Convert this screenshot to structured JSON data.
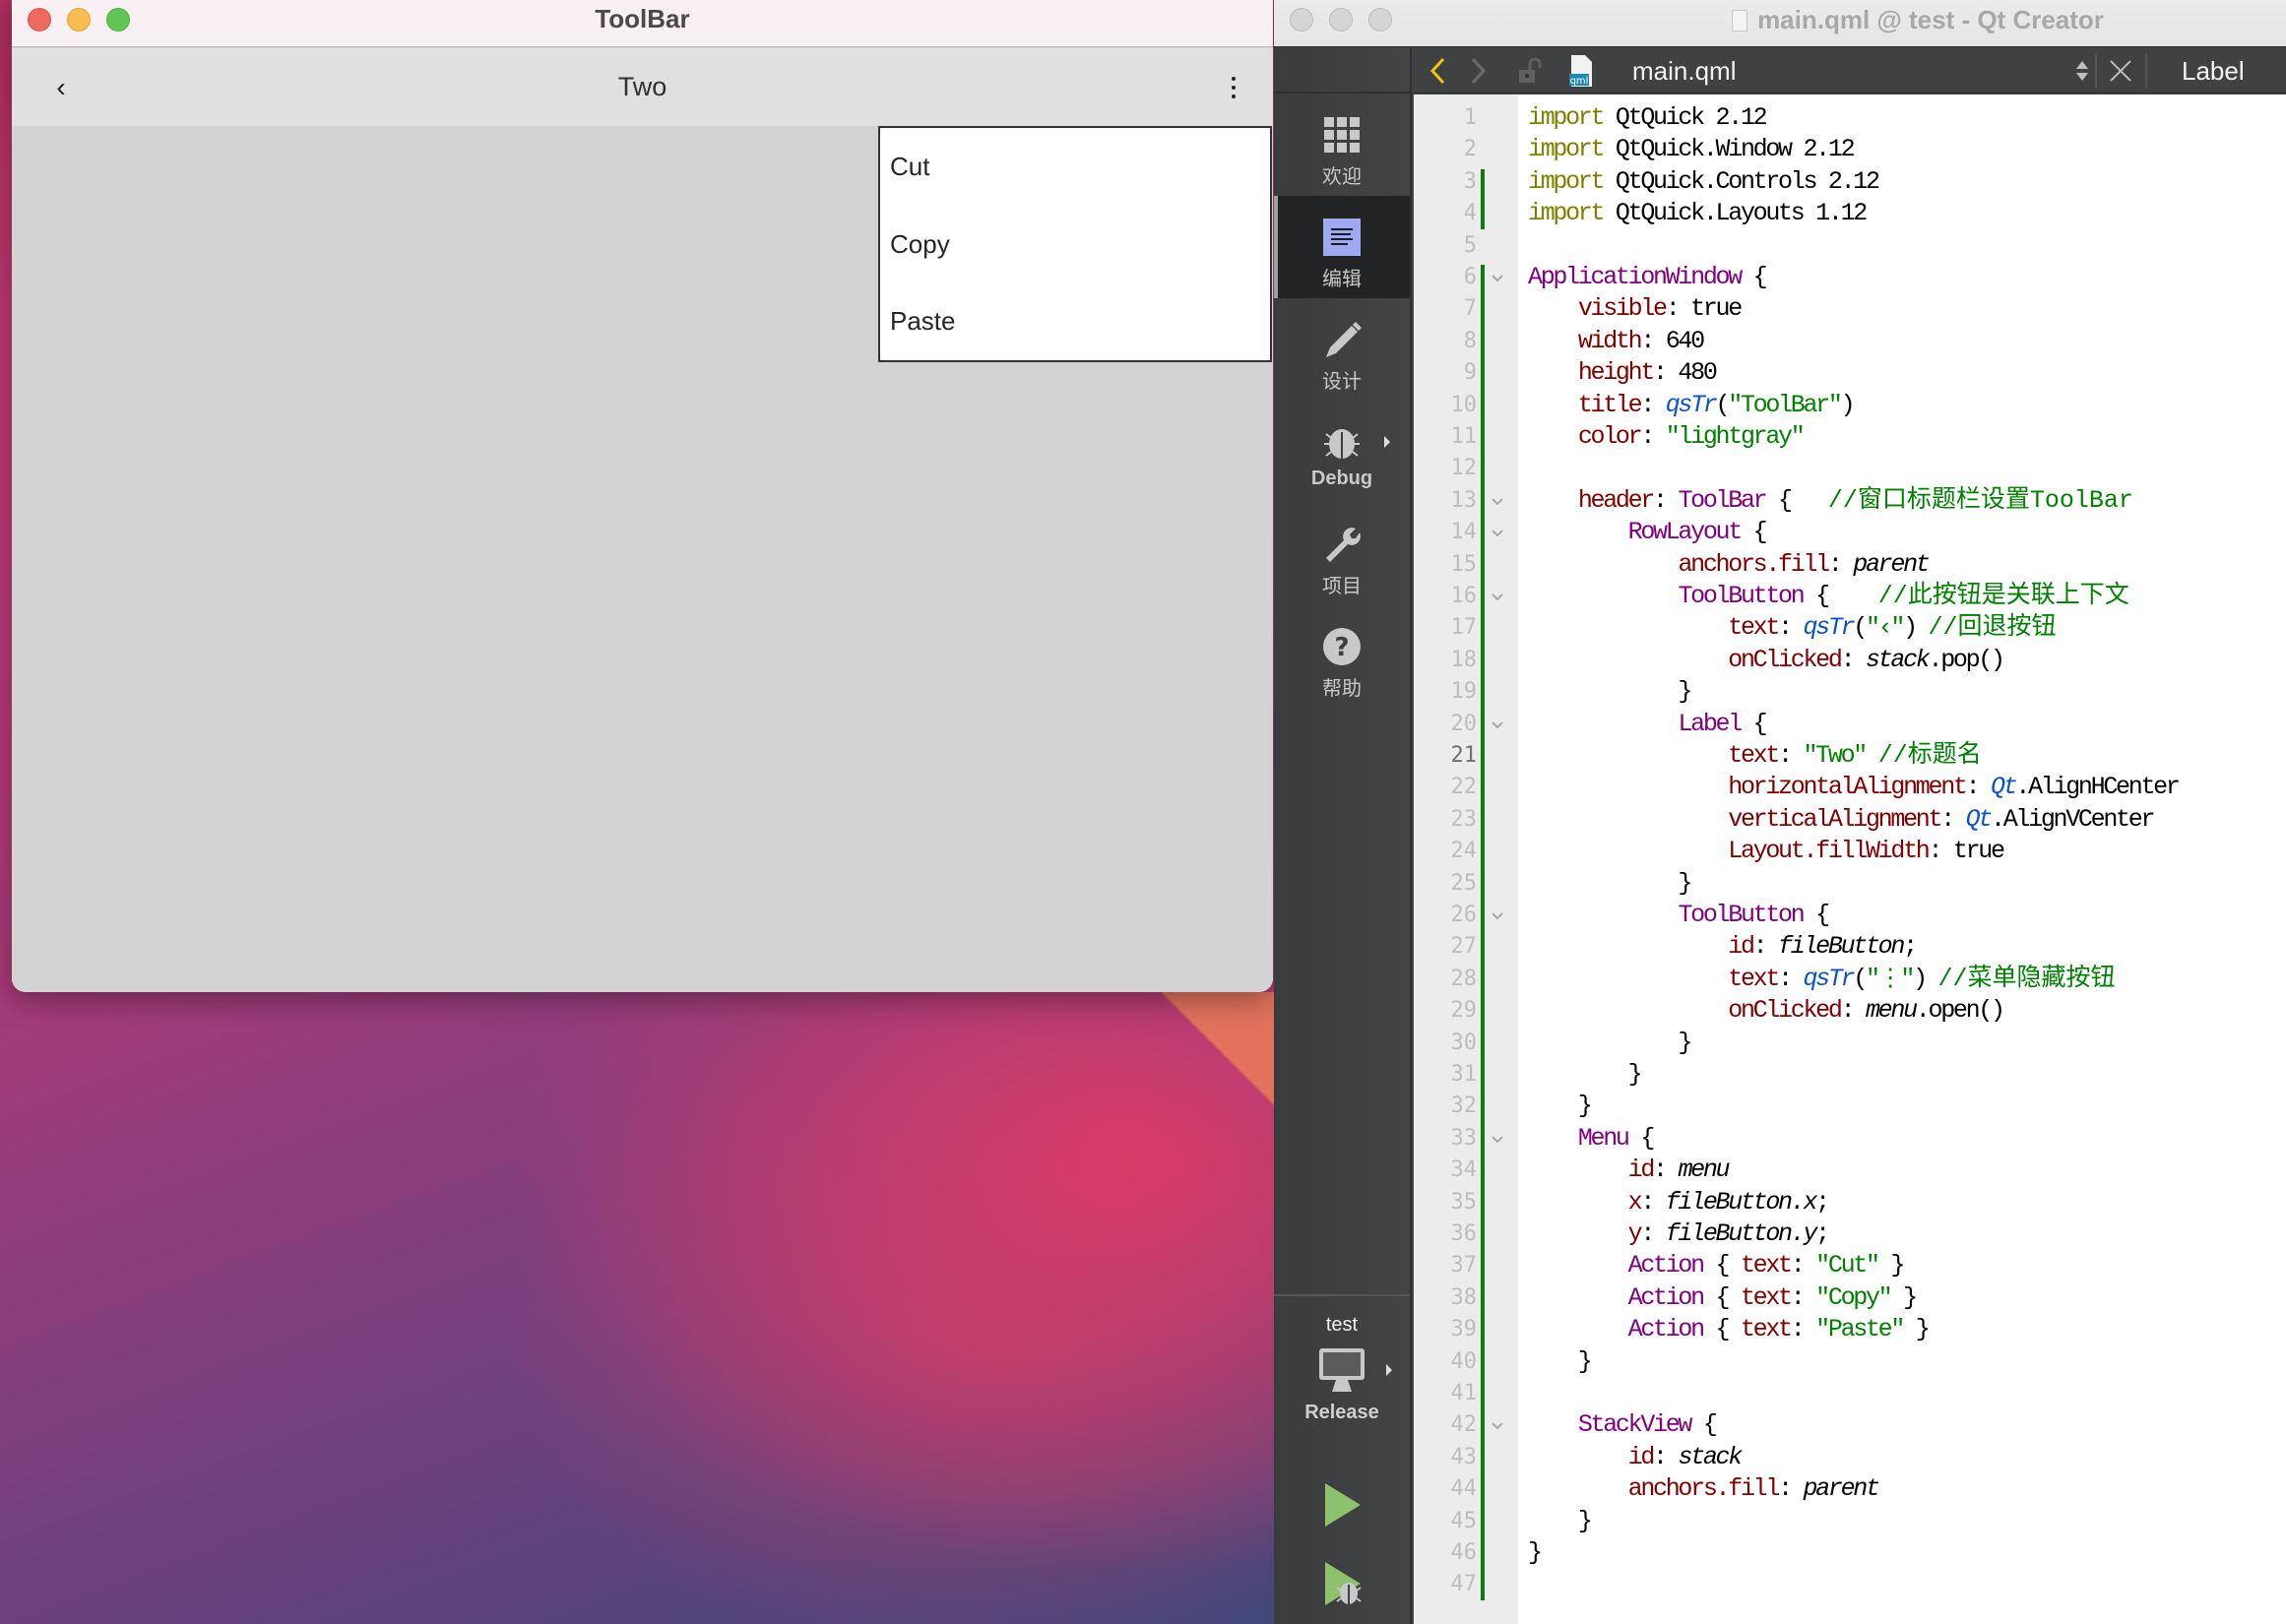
{
  "toolbar_app": {
    "window_title": "ToolBar",
    "back_button": "‹",
    "header_title": "Two",
    "more_button": "⋮",
    "menu_items": [
      "Cut",
      "Copy",
      "Paste"
    ],
    "content_color": "#d3d3d3"
  },
  "qt_creator": {
    "window_title": "main.qml @ test - Qt Creator",
    "editor_toolbar": {
      "file_name": "main.qml",
      "file_icon_label": "qml",
      "symbol": "Label"
    },
    "modes": [
      {
        "label": "欢迎",
        "icon": "grid-icon",
        "active": false
      },
      {
        "label": "编辑",
        "icon": "edit-document-icon",
        "active": true
      },
      {
        "label": "设计",
        "icon": "pencil-icon",
        "active": false
      },
      {
        "label": "Debug",
        "icon": "bug-icon",
        "active": false
      },
      {
        "label": "项目",
        "icon": "wrench-icon",
        "active": false
      },
      {
        "label": "帮助",
        "icon": "help-icon",
        "active": false
      }
    ],
    "kit": {
      "project": "test",
      "build": "Release"
    },
    "current_line": 21,
    "fold_lines": [
      6,
      13,
      14,
      16,
      20,
      26,
      33,
      42
    ],
    "changed_ranges": [
      [
        3,
        4
      ],
      [
        6,
        47
      ]
    ],
    "code_lines": [
      [
        [
          "import",
          "imp"
        ],
        [
          " QtQuick 2.12",
          ""
        ]
      ],
      [
        [
          "import",
          "imp"
        ],
        [
          " QtQuick.Window 2.12",
          ""
        ]
      ],
      [
        [
          "import",
          "imp"
        ],
        [
          " QtQuick.Controls 2.12",
          ""
        ]
      ],
      [
        [
          "import",
          "imp"
        ],
        [
          " QtQuick.Layouts 1.12",
          ""
        ]
      ],
      [],
      [
        [
          "ApplicationWindow",
          "type"
        ],
        [
          " {",
          ""
        ]
      ],
      [
        [
          "    ",
          ""
        ],
        [
          "visible",
          "prop"
        ],
        [
          ": true",
          ""
        ]
      ],
      [
        [
          "    ",
          ""
        ],
        [
          "width",
          "prop"
        ],
        [
          ": 640",
          ""
        ]
      ],
      [
        [
          "    ",
          ""
        ],
        [
          "height",
          "prop"
        ],
        [
          ": 480",
          ""
        ]
      ],
      [
        [
          "    ",
          ""
        ],
        [
          "title",
          "prop"
        ],
        [
          ": ",
          ""
        ],
        [
          "qsTr",
          "fn"
        ],
        [
          "(",
          ""
        ],
        [
          "\"ToolBar\"",
          "str"
        ],
        [
          ")",
          ""
        ]
      ],
      [
        [
          "    ",
          ""
        ],
        [
          "color",
          "prop"
        ],
        [
          ": ",
          ""
        ],
        [
          "\"lightgray\"",
          "str"
        ]
      ],
      [],
      [
        [
          "    ",
          ""
        ],
        [
          "header",
          "prop"
        ],
        [
          ": ",
          ""
        ],
        [
          "ToolBar",
          "type"
        ],
        [
          " {   ",
          ""
        ],
        [
          "//窗口标题栏设置ToolBar",
          "comment"
        ]
      ],
      [
        [
          "        ",
          ""
        ],
        [
          "RowLayout",
          "type"
        ],
        [
          " {",
          ""
        ]
      ],
      [
        [
          "            ",
          ""
        ],
        [
          "anchors.fill",
          "prop"
        ],
        [
          ": ",
          ""
        ],
        [
          "parent",
          "id"
        ]
      ],
      [
        [
          "            ",
          ""
        ],
        [
          "ToolButton",
          "type"
        ],
        [
          " {    ",
          ""
        ],
        [
          "//此按钮是关联上下文",
          "comment"
        ]
      ],
      [
        [
          "                ",
          ""
        ],
        [
          "text",
          "prop"
        ],
        [
          ": ",
          ""
        ],
        [
          "qsTr",
          "fn"
        ],
        [
          "(",
          ""
        ],
        [
          "\"‹\"",
          "str"
        ],
        [
          ") ",
          ""
        ],
        [
          "//回退按钮",
          "comment"
        ]
      ],
      [
        [
          "                ",
          ""
        ],
        [
          "onClicked",
          "prop"
        ],
        [
          ": ",
          ""
        ],
        [
          "stack",
          "id"
        ],
        [
          ".pop()",
          ""
        ]
      ],
      [
        [
          "            }",
          ""
        ]
      ],
      [
        [
          "            ",
          ""
        ],
        [
          "Label",
          "type"
        ],
        [
          " {",
          ""
        ]
      ],
      [
        [
          "                ",
          ""
        ],
        [
          "text",
          "prop"
        ],
        [
          ": ",
          ""
        ],
        [
          "\"Two\"",
          "str"
        ],
        [
          " ",
          ""
        ],
        [
          "//标题名",
          "comment"
        ]
      ],
      [
        [
          "                ",
          ""
        ],
        [
          "horizontalAlignment",
          "prop"
        ],
        [
          ": ",
          ""
        ],
        [
          "Qt",
          "ns"
        ],
        [
          ".AlignHCenter",
          ""
        ]
      ],
      [
        [
          "                ",
          ""
        ],
        [
          "verticalAlignment",
          "prop"
        ],
        [
          ": ",
          ""
        ],
        [
          "Qt",
          "ns"
        ],
        [
          ".AlignVCenter",
          ""
        ]
      ],
      [
        [
          "                ",
          ""
        ],
        [
          "Layout.fillWidth",
          "prop"
        ],
        [
          ": true",
          ""
        ]
      ],
      [
        [
          "            }",
          ""
        ]
      ],
      [
        [
          "            ",
          ""
        ],
        [
          "ToolButton",
          "type"
        ],
        [
          " {",
          ""
        ]
      ],
      [
        [
          "                ",
          ""
        ],
        [
          "id",
          "prop"
        ],
        [
          ": ",
          ""
        ],
        [
          "fileButton",
          "id"
        ],
        [
          ";",
          ""
        ]
      ],
      [
        [
          "                ",
          ""
        ],
        [
          "text",
          "prop"
        ],
        [
          ": ",
          ""
        ],
        [
          "qsTr",
          "fn"
        ],
        [
          "(",
          ""
        ],
        [
          "\"⋮\"",
          "str"
        ],
        [
          ") ",
          ""
        ],
        [
          "//菜单隐藏按钮",
          "comment"
        ]
      ],
      [
        [
          "                ",
          ""
        ],
        [
          "onClicked",
          "prop"
        ],
        [
          ": ",
          ""
        ],
        [
          "menu",
          "id"
        ],
        [
          ".open()",
          ""
        ]
      ],
      [
        [
          "            }",
          ""
        ]
      ],
      [
        [
          "        }",
          ""
        ]
      ],
      [
        [
          "    }",
          ""
        ]
      ],
      [
        [
          "    ",
          ""
        ],
        [
          "Menu",
          "type"
        ],
        [
          " {",
          ""
        ]
      ],
      [
        [
          "        ",
          ""
        ],
        [
          "id",
          "prop"
        ],
        [
          ": ",
          ""
        ],
        [
          "menu",
          "id"
        ]
      ],
      [
        [
          "        ",
          ""
        ],
        [
          "x",
          "prop"
        ],
        [
          ": ",
          ""
        ],
        [
          "fileButton.x",
          "id"
        ],
        [
          ";",
          ""
        ]
      ],
      [
        [
          "        ",
          ""
        ],
        [
          "y",
          "prop"
        ],
        [
          ": ",
          ""
        ],
        [
          "fileButton.y",
          "id"
        ],
        [
          ";",
          ""
        ]
      ],
      [
        [
          "        ",
          ""
        ],
        [
          "Action",
          "type"
        ],
        [
          " { ",
          ""
        ],
        [
          "text",
          "prop"
        ],
        [
          ": ",
          ""
        ],
        [
          "\"Cut\"",
          "str"
        ],
        [
          " }",
          ""
        ]
      ],
      [
        [
          "        ",
          ""
        ],
        [
          "Action",
          "type"
        ],
        [
          " { ",
          ""
        ],
        [
          "text",
          "prop"
        ],
        [
          ": ",
          ""
        ],
        [
          "\"Copy\"",
          "str"
        ],
        [
          " }",
          ""
        ]
      ],
      [
        [
          "        ",
          ""
        ],
        [
          "Action",
          "type"
        ],
        [
          " { ",
          ""
        ],
        [
          "text",
          "prop"
        ],
        [
          ": ",
          ""
        ],
        [
          "\"Paste\"",
          "str"
        ],
        [
          " }",
          ""
        ]
      ],
      [
        [
          "    }",
          ""
        ]
      ],
      [],
      [
        [
          "    ",
          ""
        ],
        [
          "StackView",
          "type"
        ],
        [
          " {",
          ""
        ]
      ],
      [
        [
          "        ",
          ""
        ],
        [
          "id",
          "prop"
        ],
        [
          ": ",
          ""
        ],
        [
          "stack",
          "id"
        ]
      ],
      [
        [
          "        ",
          ""
        ],
        [
          "anchors.fill",
          "prop"
        ],
        [
          ": ",
          ""
        ],
        [
          "parent",
          "id"
        ]
      ],
      [
        [
          "    }",
          ""
        ]
      ],
      [
        [
          "}",
          ""
        ]
      ],
      []
    ]
  }
}
